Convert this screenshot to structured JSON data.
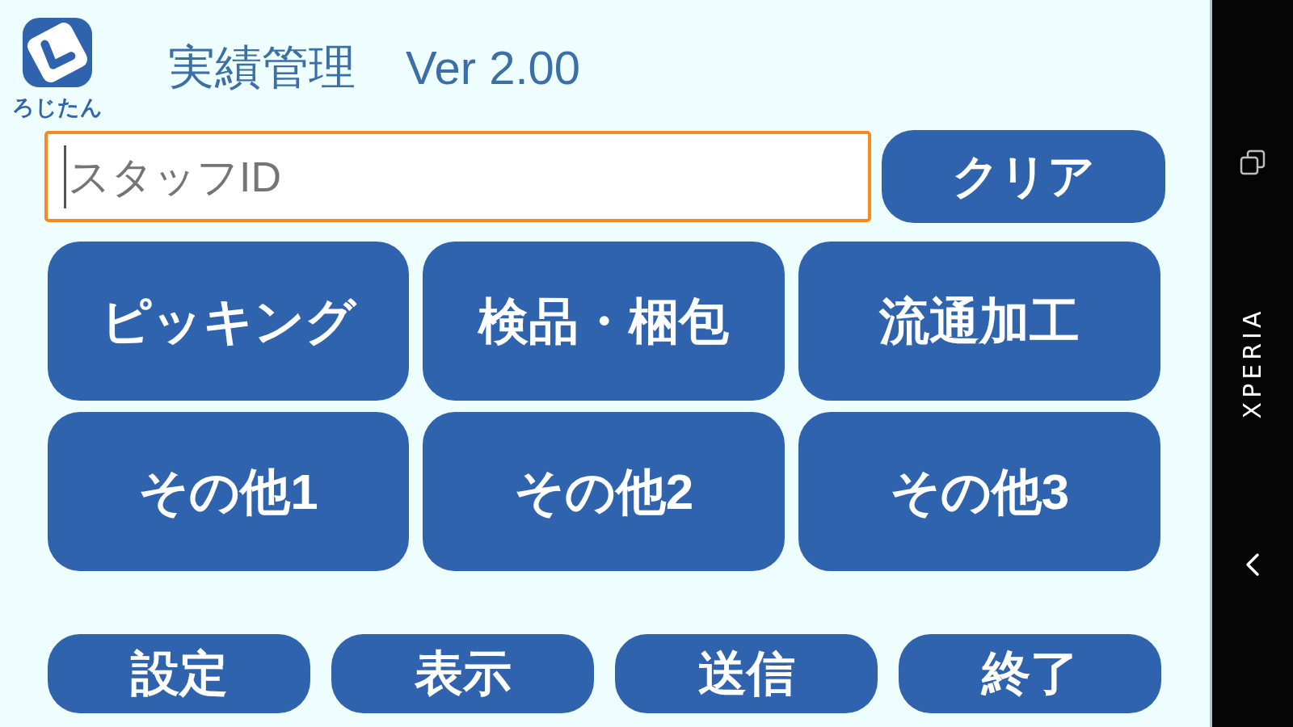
{
  "app_header": {
    "logo_caption": "ろじたん",
    "title": "実績管理",
    "version": "Ver 2.00"
  },
  "staff_id_field": {
    "placeholder": "スタッフID",
    "focused": true
  },
  "clear_button": {
    "label": "クリア"
  },
  "task_buttons": [
    {
      "label": "ピッキング"
    },
    {
      "label": "検品・梱包"
    },
    {
      "label": "流通加工"
    },
    {
      "label": "その他1"
    },
    {
      "label": "その他2"
    },
    {
      "label": "その他3"
    }
  ],
  "footer_buttons": [
    {
      "label": "設定"
    },
    {
      "label": "表示"
    },
    {
      "label": "送信"
    },
    {
      "label": "終了"
    }
  ],
  "navigation_bar": {
    "brand": "XPERIA"
  }
}
